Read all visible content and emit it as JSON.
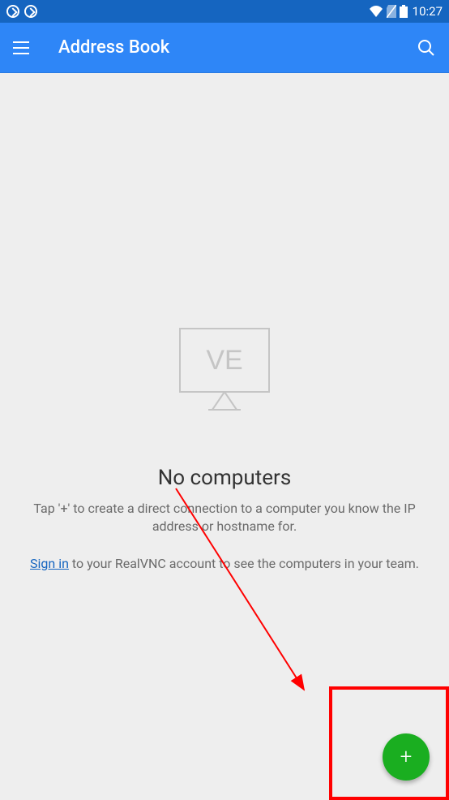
{
  "status_bar": {
    "time": "10:27"
  },
  "app_bar": {
    "title": "Address Book"
  },
  "empty_state": {
    "illustration_text": "VE",
    "title": "No computers",
    "subtitle": "Tap '+' to create a direct connection to a computer you know the IP address or hostname for.",
    "signin_link": "Sign in",
    "signin_rest": " to your RealVNC account to see the computers in your team."
  },
  "fab": {
    "label": "+"
  }
}
